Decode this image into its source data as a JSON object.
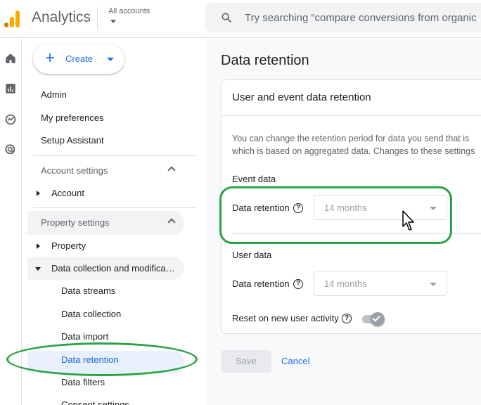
{
  "app": {
    "brand": "Analytics"
  },
  "accounts": {
    "label": "All accounts"
  },
  "search": {
    "placeholder": "Try searching “compare conversions from organic"
  },
  "rail": {
    "icons": [
      "home-icon",
      "reports-icon",
      "explore-icon",
      "advertising-icon"
    ]
  },
  "nav": {
    "create_label": "Create",
    "top_items": [
      "Admin",
      "My preferences",
      "Setup Assistant"
    ],
    "account_settings": {
      "label": "Account settings",
      "items": [
        "Account"
      ]
    },
    "property_settings": {
      "label": "Property settings",
      "items": [
        "Property",
        "Data collection and modifica…"
      ],
      "sub_items": [
        "Data streams",
        "Data collection",
        "Data import",
        "Data retention",
        "Data filters",
        "Consent settings"
      ]
    }
  },
  "main": {
    "page_title": "Data retention",
    "card_title": "User and event data retention",
    "description_lines": [
      "You can change the retention period for data you send that is",
      "which is based on aggregated data. Changes to these settings"
    ],
    "event_data": {
      "heading": "Event data",
      "field_label": "Data retention",
      "value": "14 months"
    },
    "user_data": {
      "heading": "User data",
      "field_label": "Data retention",
      "value": "14 months"
    },
    "reset_label": "Reset on new user activity",
    "reset_enabled": true,
    "save_label": "Save",
    "cancel_label": "Cancel"
  },
  "colors": {
    "accent": "#1a73e8",
    "selected_bg": "#e8f0fe",
    "highlight_annotation": "#2aa245",
    "logo_orange": "#e37400",
    "logo_yellow": "#f9ab00"
  }
}
